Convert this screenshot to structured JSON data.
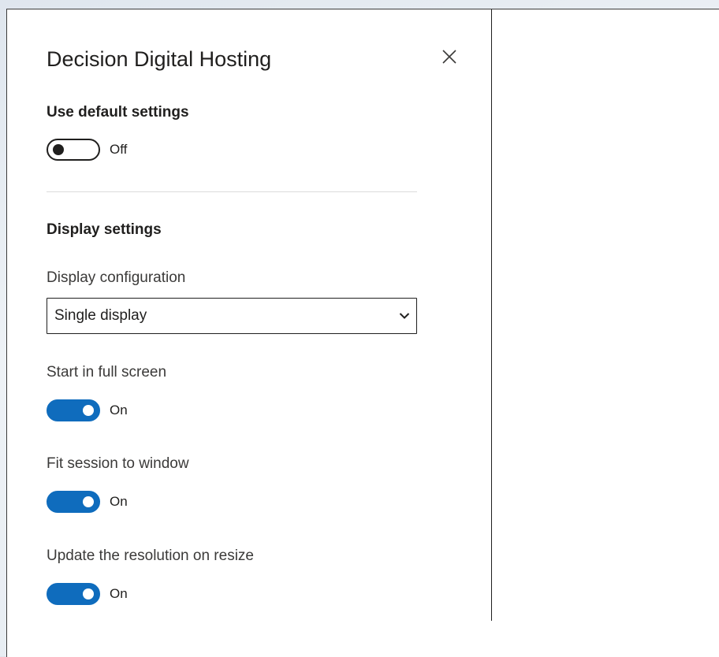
{
  "panel": {
    "title": "Decision Digital Hosting",
    "close_icon": "close-icon"
  },
  "default_settings": {
    "heading": "Use default settings",
    "toggle_state": "Off"
  },
  "display_settings": {
    "heading": "Display settings",
    "configuration": {
      "label": "Display configuration",
      "selected": "Single display",
      "icon": "chevron-down-icon"
    },
    "full_screen": {
      "label": "Start in full screen",
      "state": "On"
    },
    "fit_session": {
      "label": "Fit session to window",
      "state": "On"
    },
    "update_resolution": {
      "label": "Update the resolution on resize",
      "state": "On"
    }
  },
  "colors": {
    "accent": "#0f6cbd",
    "text": "#201f1e",
    "divider": "#dcdcdc"
  }
}
